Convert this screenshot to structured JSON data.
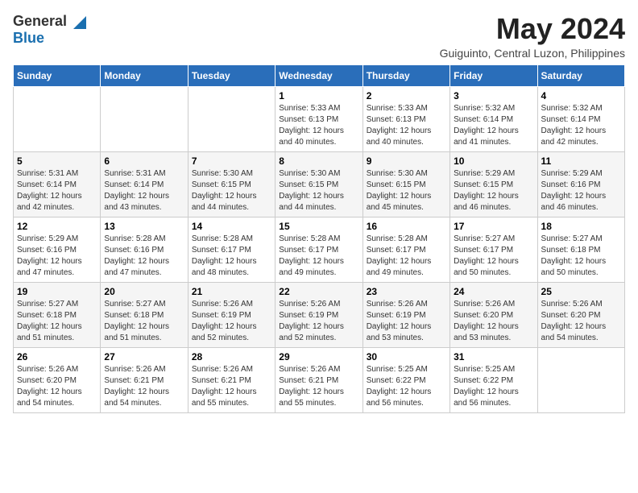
{
  "header": {
    "logo_general": "General",
    "logo_blue": "Blue",
    "month_title": "May 2024",
    "location": "Guiguinto, Central Luzon, Philippines"
  },
  "days_of_week": [
    "Sunday",
    "Monday",
    "Tuesday",
    "Wednesday",
    "Thursday",
    "Friday",
    "Saturday"
  ],
  "weeks": [
    [
      {
        "day": "",
        "info": ""
      },
      {
        "day": "",
        "info": ""
      },
      {
        "day": "",
        "info": ""
      },
      {
        "day": "1",
        "info": "Sunrise: 5:33 AM\nSunset: 6:13 PM\nDaylight: 12 hours\nand 40 minutes."
      },
      {
        "day": "2",
        "info": "Sunrise: 5:33 AM\nSunset: 6:13 PM\nDaylight: 12 hours\nand 40 minutes."
      },
      {
        "day": "3",
        "info": "Sunrise: 5:32 AM\nSunset: 6:14 PM\nDaylight: 12 hours\nand 41 minutes."
      },
      {
        "day": "4",
        "info": "Sunrise: 5:32 AM\nSunset: 6:14 PM\nDaylight: 12 hours\nand 42 minutes."
      }
    ],
    [
      {
        "day": "5",
        "info": "Sunrise: 5:31 AM\nSunset: 6:14 PM\nDaylight: 12 hours\nand 42 minutes."
      },
      {
        "day": "6",
        "info": "Sunrise: 5:31 AM\nSunset: 6:14 PM\nDaylight: 12 hours\nand 43 minutes."
      },
      {
        "day": "7",
        "info": "Sunrise: 5:30 AM\nSunset: 6:15 PM\nDaylight: 12 hours\nand 44 minutes."
      },
      {
        "day": "8",
        "info": "Sunrise: 5:30 AM\nSunset: 6:15 PM\nDaylight: 12 hours\nand 44 minutes."
      },
      {
        "day": "9",
        "info": "Sunrise: 5:30 AM\nSunset: 6:15 PM\nDaylight: 12 hours\nand 45 minutes."
      },
      {
        "day": "10",
        "info": "Sunrise: 5:29 AM\nSunset: 6:15 PM\nDaylight: 12 hours\nand 46 minutes."
      },
      {
        "day": "11",
        "info": "Sunrise: 5:29 AM\nSunset: 6:16 PM\nDaylight: 12 hours\nand 46 minutes."
      }
    ],
    [
      {
        "day": "12",
        "info": "Sunrise: 5:29 AM\nSunset: 6:16 PM\nDaylight: 12 hours\nand 47 minutes."
      },
      {
        "day": "13",
        "info": "Sunrise: 5:28 AM\nSunset: 6:16 PM\nDaylight: 12 hours\nand 47 minutes."
      },
      {
        "day": "14",
        "info": "Sunrise: 5:28 AM\nSunset: 6:17 PM\nDaylight: 12 hours\nand 48 minutes."
      },
      {
        "day": "15",
        "info": "Sunrise: 5:28 AM\nSunset: 6:17 PM\nDaylight: 12 hours\nand 49 minutes."
      },
      {
        "day": "16",
        "info": "Sunrise: 5:28 AM\nSunset: 6:17 PM\nDaylight: 12 hours\nand 49 minutes."
      },
      {
        "day": "17",
        "info": "Sunrise: 5:27 AM\nSunset: 6:17 PM\nDaylight: 12 hours\nand 50 minutes."
      },
      {
        "day": "18",
        "info": "Sunrise: 5:27 AM\nSunset: 6:18 PM\nDaylight: 12 hours\nand 50 minutes."
      }
    ],
    [
      {
        "day": "19",
        "info": "Sunrise: 5:27 AM\nSunset: 6:18 PM\nDaylight: 12 hours\nand 51 minutes."
      },
      {
        "day": "20",
        "info": "Sunrise: 5:27 AM\nSunset: 6:18 PM\nDaylight: 12 hours\nand 51 minutes."
      },
      {
        "day": "21",
        "info": "Sunrise: 5:26 AM\nSunset: 6:19 PM\nDaylight: 12 hours\nand 52 minutes."
      },
      {
        "day": "22",
        "info": "Sunrise: 5:26 AM\nSunset: 6:19 PM\nDaylight: 12 hours\nand 52 minutes."
      },
      {
        "day": "23",
        "info": "Sunrise: 5:26 AM\nSunset: 6:19 PM\nDaylight: 12 hours\nand 53 minutes."
      },
      {
        "day": "24",
        "info": "Sunrise: 5:26 AM\nSunset: 6:20 PM\nDaylight: 12 hours\nand 53 minutes."
      },
      {
        "day": "25",
        "info": "Sunrise: 5:26 AM\nSunset: 6:20 PM\nDaylight: 12 hours\nand 54 minutes."
      }
    ],
    [
      {
        "day": "26",
        "info": "Sunrise: 5:26 AM\nSunset: 6:20 PM\nDaylight: 12 hours\nand 54 minutes."
      },
      {
        "day": "27",
        "info": "Sunrise: 5:26 AM\nSunset: 6:21 PM\nDaylight: 12 hours\nand 54 minutes."
      },
      {
        "day": "28",
        "info": "Sunrise: 5:26 AM\nSunset: 6:21 PM\nDaylight: 12 hours\nand 55 minutes."
      },
      {
        "day": "29",
        "info": "Sunrise: 5:26 AM\nSunset: 6:21 PM\nDaylight: 12 hours\nand 55 minutes."
      },
      {
        "day": "30",
        "info": "Sunrise: 5:25 AM\nSunset: 6:22 PM\nDaylight: 12 hours\nand 56 minutes."
      },
      {
        "day": "31",
        "info": "Sunrise: 5:25 AM\nSunset: 6:22 PM\nDaylight: 12 hours\nand 56 minutes."
      },
      {
        "day": "",
        "info": ""
      }
    ]
  ]
}
